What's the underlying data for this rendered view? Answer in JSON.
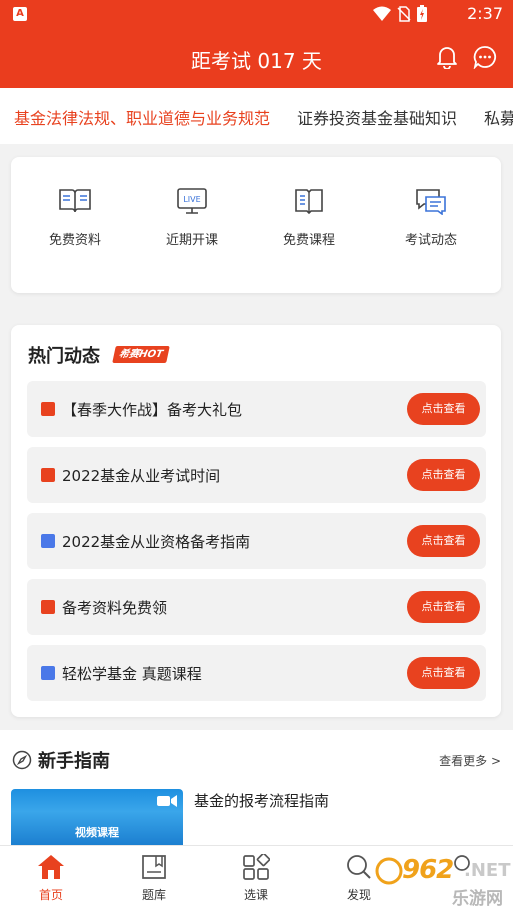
{
  "status_bar": {
    "time": "2:37",
    "app_badge": "A"
  },
  "header": {
    "title": "距考试 017 天"
  },
  "tabs": [
    "基金法律法规、职业道德与业务规范",
    "证券投资基金基础知识",
    "私募"
  ],
  "quick_links": [
    {
      "label": "免费资料",
      "icon": "open-book-icon"
    },
    {
      "label": "近期开课",
      "icon": "live-monitor-icon"
    },
    {
      "label": "免费课程",
      "icon": "course-book-icon"
    },
    {
      "label": "考试动态",
      "icon": "news-chat-icon"
    }
  ],
  "hot": {
    "title": "热门动态",
    "badge": "希赛HOT",
    "items": [
      {
        "text": "【春季大作战】备考大礼包",
        "icon": "bookmark",
        "button": "点击查看"
      },
      {
        "text": "2022基金从业考试时间",
        "icon": "bookmark",
        "button": "点击查看"
      },
      {
        "text": "2022基金从业资格备考指南",
        "icon": "play",
        "button": "点击查看"
      },
      {
        "text": "备考资料免费领",
        "icon": "bookmark",
        "button": "点击查看"
      },
      {
        "text": "轻松学基金 真题课程",
        "icon": "play",
        "button": "点击查看"
      }
    ]
  },
  "guide": {
    "title": "新手指南",
    "more": "查看更多 >",
    "video_label": "视频课程",
    "item_title": "基金的报考流程指南"
  },
  "bottom_nav": [
    {
      "label": "首页",
      "icon": "home-icon",
      "active": true
    },
    {
      "label": "题库",
      "icon": "question-bank-icon",
      "active": false
    },
    {
      "label": "选课",
      "icon": "select-course-icon",
      "active": false
    },
    {
      "label": "发现",
      "icon": "discover-icon",
      "active": false
    },
    {
      "label": "",
      "icon": "profile-icon",
      "active": false
    }
  ],
  "watermark": {
    "num": "962",
    "net": ".NET",
    "cn": "乐游网"
  },
  "colors": {
    "primary": "#ea3d1e",
    "accent": "#e8421f",
    "play_blue": "#4a78e8",
    "background": "#f2f2f2"
  }
}
